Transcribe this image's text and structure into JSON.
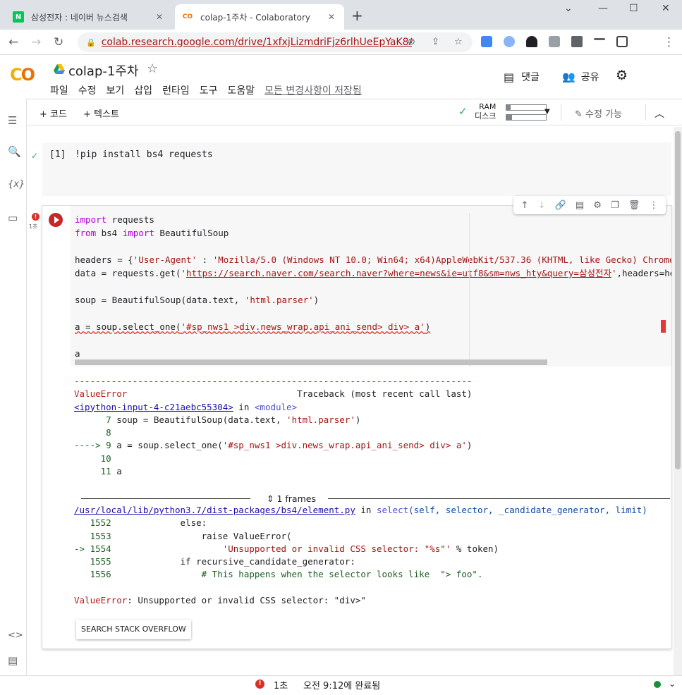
{
  "browser": {
    "tabs": [
      {
        "title": "삼성전자 : 네이버 뉴스검색",
        "favicon": "N"
      },
      {
        "title": "colap-1주차 - Colaboratory",
        "favicon": "CO"
      }
    ],
    "url": "colab.research.google.com/drive/1xfxjLizmdriFjz6rlhUeEpYaK8Aiw..."
  },
  "colab": {
    "notebook_title": "colap-1주차",
    "menus": [
      "파일",
      "수정",
      "보기",
      "삽입",
      "런타임",
      "도구",
      "도움말"
    ],
    "saved_status": "모든 변경사항이 저장됨",
    "comment_label": "댓글",
    "share_label": "공유",
    "add_code": "+ 코드",
    "add_text": "+ 텍스트",
    "ram_label": "RAM",
    "disk_label": "디스크",
    "ram_usage_fraction": 0.1,
    "disk_usage_fraction": 0.15,
    "edit_label": "수정 가능"
  },
  "cell1": {
    "count": "[1]",
    "code": "!pip install bs4 requests"
  },
  "cell2": {
    "exec_time": "1초",
    "traceback": {
      "dashes": "---------------------------------------------------------------------------",
      "error_name": "ValueError",
      "traceback_label": "Traceback (most recent call last)",
      "input_link": "<ipython-input-4-c21aebc55304>",
      "in_word": " in ",
      "module": "<module>",
      "frames_label": "1 frames",
      "file_link": "/usr/local/lib/python3.7/dist-packages/bs4/element.py",
      "func": "select",
      "func_args": "(self, selector, _candidate_generator, limit)",
      "final_message": ": Unsupported or invalid CSS selector: \"div>\""
    },
    "so_button": "SEARCH STACK OVERFLOW"
  },
  "status_bar": {
    "elapsed": "1초",
    "completed": "오전 9:12에 완료됨"
  }
}
